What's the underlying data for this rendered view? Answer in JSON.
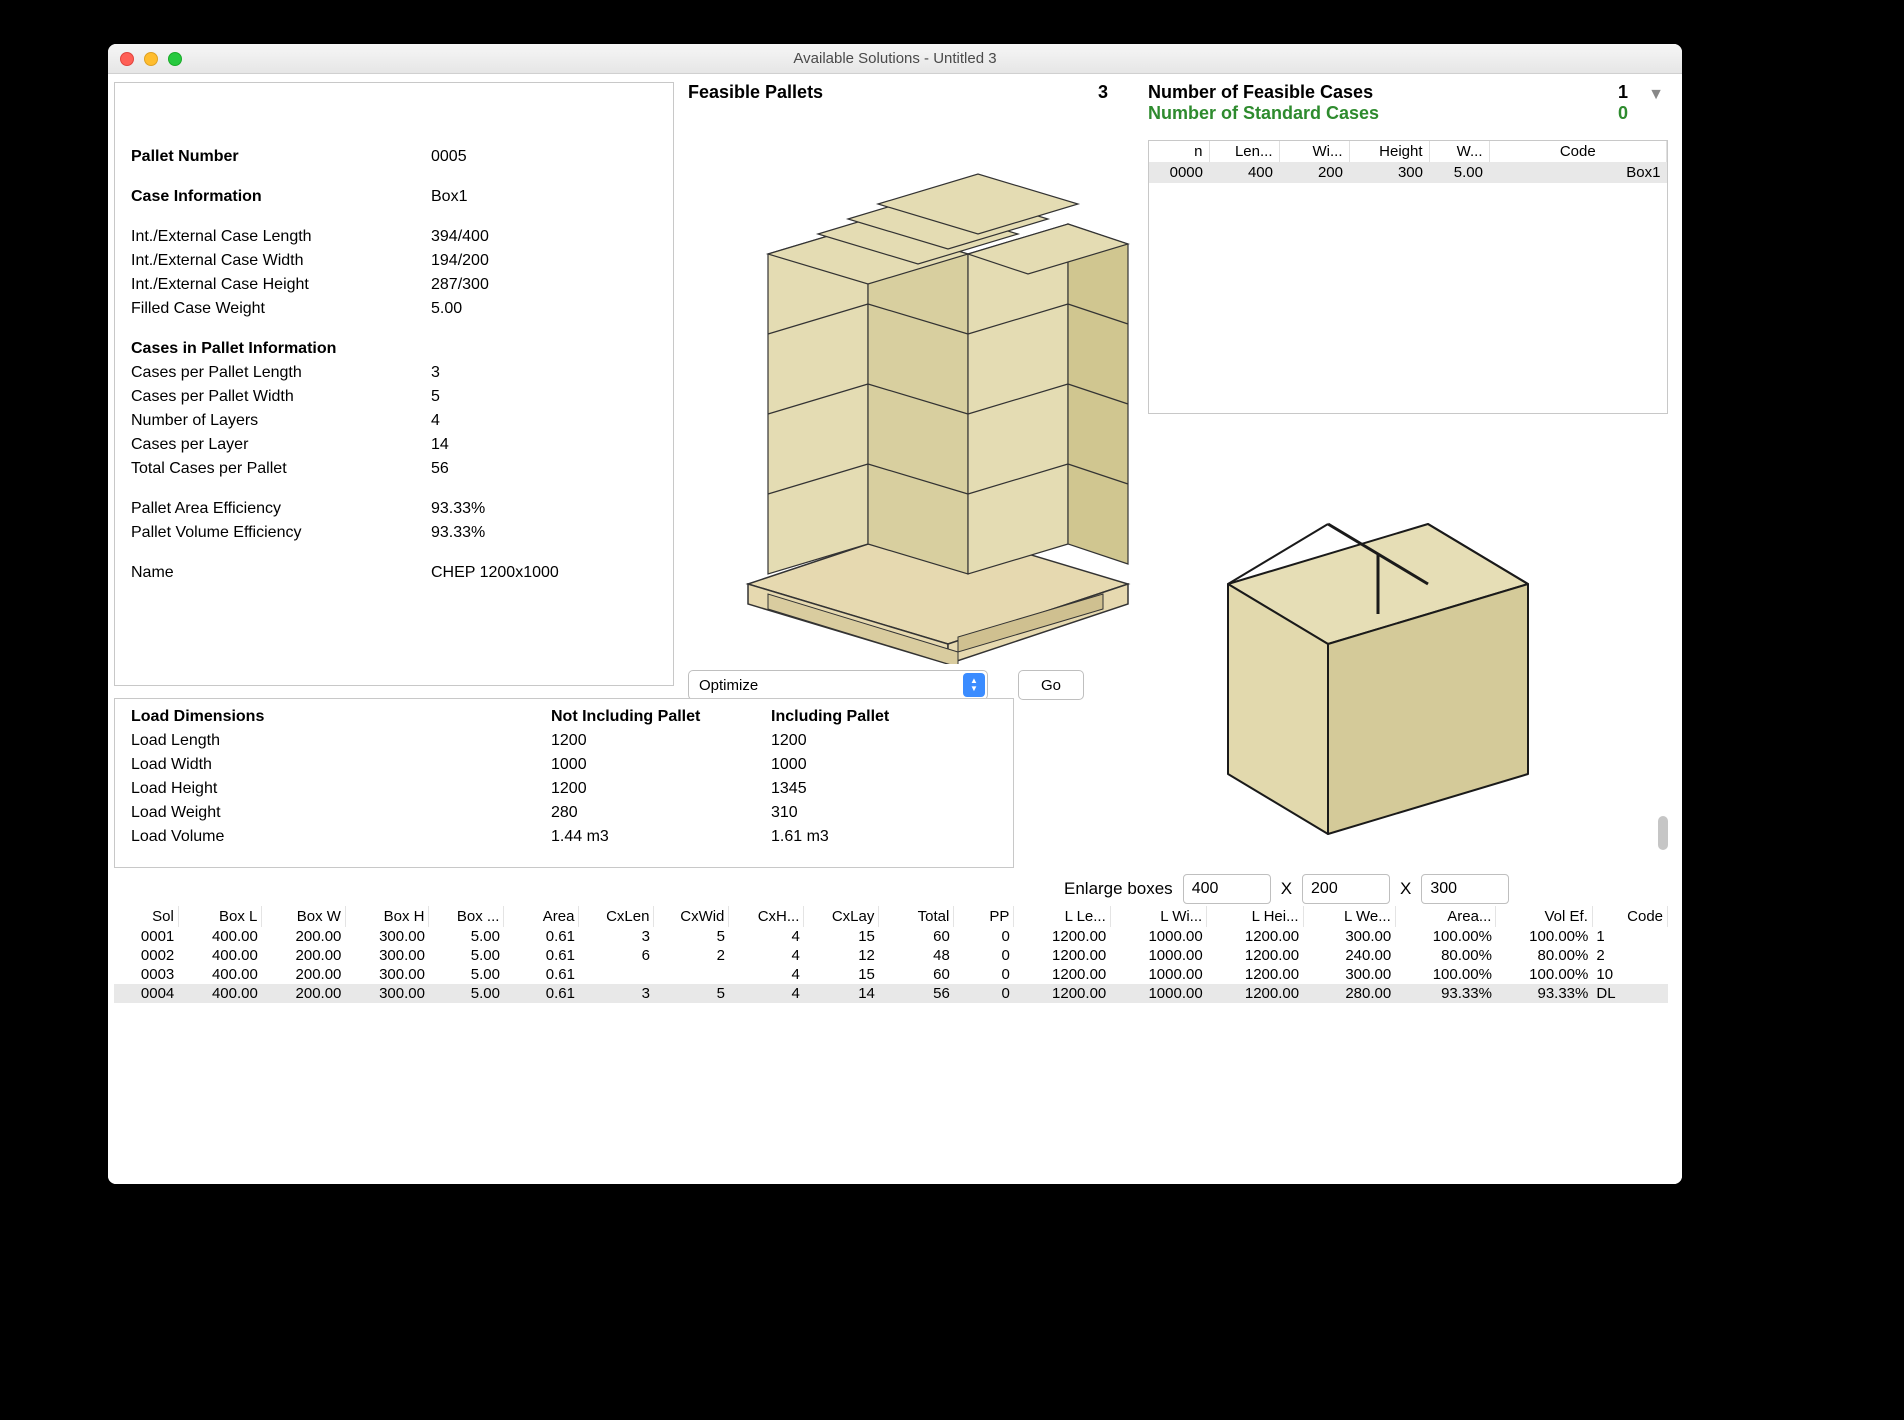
{
  "window_title": "Available Solutions - Untitled 3",
  "info": {
    "pallet_number_label": "Pallet Number",
    "pallet_number": "0005",
    "case_info_label": "Case Information",
    "case_info": "Box1",
    "len_label": "Int./External Case Length",
    "len": "394/400",
    "wid_label": "Int./External Case Width",
    "wid": "194/200",
    "hei_label": "Int./External Case Height",
    "hei": "287/300",
    "weight_label": "Filled Case Weight",
    "weight": "5.00",
    "cip_label": "Cases in Pallet Information",
    "cpl_label": "Cases per Pallet Length",
    "cpl": "3",
    "cpw_label": "Cases per Pallet Width",
    "cpw": "5",
    "nl_label": "Number of Layers",
    "nl": "4",
    "clayer_label": "Cases per Layer",
    "clayer": "14",
    "tcp_label": "Total Cases per Pallet",
    "tcp": "56",
    "area_eff_label": "Pallet Area Efficiency",
    "area_eff": "93.33%",
    "vol_eff_label": "Pallet Volume Efficiency",
    "vol_eff": "93.33%",
    "name_label": "Name",
    "name": "CHEP 1200x1000"
  },
  "feasible": {
    "label": "Feasible Pallets",
    "count": "3"
  },
  "optimize": {
    "selected": "Optimize",
    "go": "Go"
  },
  "load": {
    "header": "Load Dimensions",
    "col1": "Not Including Pallet",
    "col2": "Including Pallet",
    "rows": [
      {
        "label": "Load Length",
        "a": "1200",
        "b": "1200"
      },
      {
        "label": "Load Width",
        "a": "1000",
        "b": "1000"
      },
      {
        "label": "Load Height",
        "a": "1200",
        "b": "1345"
      },
      {
        "label": "Load Weight",
        "a": "280",
        "b": "310"
      },
      {
        "label": "Load Volume",
        "a": "1.44 m3",
        "b": "1.61 m3"
      }
    ]
  },
  "cases": {
    "feasible_label": "Number of Feasible Cases",
    "feasible_count": "1",
    "standard_label": "Number of Standard Cases",
    "standard_count": "0",
    "headers": [
      "n",
      "Len...",
      "Wi...",
      "Height",
      "W...",
      "Code"
    ],
    "row": {
      "n": "0000",
      "len": "400",
      "wid": "200",
      "hei": "300",
      "w": "5.00",
      "code": "Box1"
    }
  },
  "enlarge": {
    "label": "Enlarge boxes",
    "x": "X",
    "a": "400",
    "b": "200",
    "c": "300"
  },
  "sol": {
    "headers": [
      "Sol",
      "Box L",
      "Box W",
      "Box H",
      "Box ...",
      "Area",
      "CxLen",
      "CxWid",
      "CxH...",
      "CxLay",
      "Total",
      "PP",
      "L Le...",
      "L Wi...",
      "L Hei...",
      "L We...",
      "Area...",
      "Vol Ef.",
      "Code"
    ],
    "rows": [
      [
        "0001",
        "400.00",
        "200.00",
        "300.00",
        "5.00",
        "0.61",
        "3",
        "5",
        "4",
        "15",
        "60",
        "0",
        "1200.00",
        "1000.00",
        "1200.00",
        "300.00",
        "100.00%",
        "100.00%",
        "1"
      ],
      [
        "0002",
        "400.00",
        "200.00",
        "300.00",
        "5.00",
        "0.61",
        "6",
        "2",
        "4",
        "12",
        "48",
        "0",
        "1200.00",
        "1000.00",
        "1200.00",
        "240.00",
        "80.00%",
        "80.00%",
        "2"
      ],
      [
        "0003",
        "400.00",
        "200.00",
        "300.00",
        "5.00",
        "0.61",
        "",
        "",
        "4",
        "15",
        "60",
        "0",
        "1200.00",
        "1000.00",
        "1200.00",
        "300.00",
        "100.00%",
        "100.00%",
        "10"
      ],
      [
        "0004",
        "400.00",
        "200.00",
        "300.00",
        "5.00",
        "0.61",
        "3",
        "5",
        "4",
        "14",
        "56",
        "0",
        "1200.00",
        "1000.00",
        "1200.00",
        "280.00",
        "93.33%",
        "93.33%",
        "DL"
      ]
    ],
    "selected_index": 3
  }
}
